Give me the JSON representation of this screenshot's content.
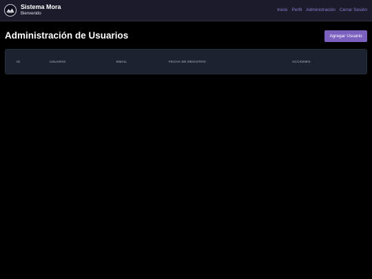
{
  "header": {
    "brand_title": "Sistema Mora",
    "brand_subtitle": "Bienvenido",
    "logo_icon": "company-logo",
    "nav": [
      {
        "label": "Inicio"
      },
      {
        "label": "Perfil"
      },
      {
        "label": "Administración"
      },
      {
        "label": "Cerrar Sesión"
      }
    ]
  },
  "main": {
    "title": "Administración de Usuarios",
    "add_button_label": "Agregar Usuario",
    "table": {
      "columns": [
        "ID",
        "USUARIO",
        "EMAIL",
        "FECHA DE REGISTRO",
        "ACCIONES"
      ],
      "rows": []
    }
  },
  "colors": {
    "background": "#000000",
    "header": "#1b1b2c",
    "accent": "#7b60c0",
    "nav_link": "#8e7fd6",
    "table_header": "#1c2230"
  }
}
